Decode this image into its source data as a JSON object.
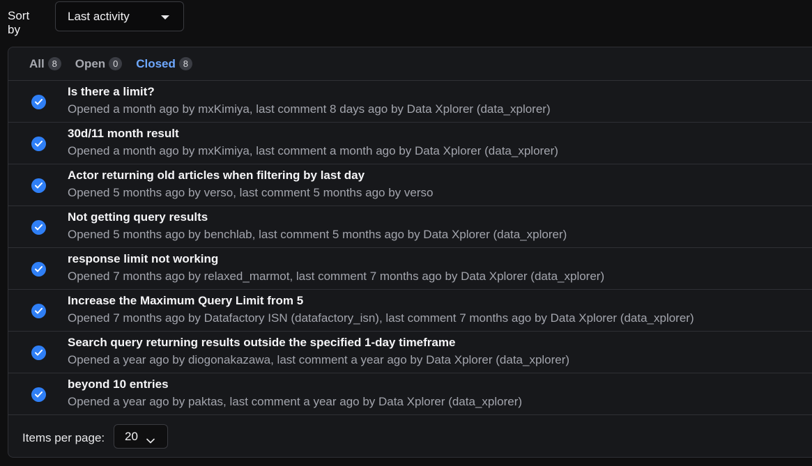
{
  "sort": {
    "label": "Sort by",
    "value": "Last activity"
  },
  "tabs": [
    {
      "label": "All",
      "count": "8"
    },
    {
      "label": "Open",
      "count": "0"
    },
    {
      "label": "Closed",
      "count": "8"
    }
  ],
  "issues": [
    {
      "title": "Is there a limit?",
      "meta": "Opened a month ago by mxKimiya, last comment 8 days ago by Data Xplorer (data_xplorer)"
    },
    {
      "title": "30d/11 month result",
      "meta": "Opened a month ago by mxKimiya, last comment a month ago by Data Xplorer (data_xplorer)"
    },
    {
      "title": "Actor returning old articles when filtering by last day",
      "meta": "Opened 5 months ago by verso, last comment 5 months ago by verso"
    },
    {
      "title": "Not getting query results",
      "meta": "Opened 5 months ago by benchlab, last comment 5 months ago by Data Xplorer (data_xplorer)"
    },
    {
      "title": "response limit not working",
      "meta": "Opened 7 months ago by relaxed_marmot, last comment 7 months ago by Data Xplorer (data_xplorer)"
    },
    {
      "title": "Increase the Maximum Query Limit from 5",
      "meta": "Opened 7 months ago by Datafactory ISN (datafactory_isn), last comment 7 months ago by Data Xplorer (data_xplorer)"
    },
    {
      "title": "Search query returning results outside the specified 1-day timeframe",
      "meta": "Opened a year ago by diogonakazawa, last comment a year ago by Data Xplorer (data_xplorer)"
    },
    {
      "title": "beyond 10 entries",
      "meta": "Opened a year ago by paktas, last comment a year ago by Data Xplorer (data_xplorer)"
    }
  ],
  "pagination": {
    "items_per_page_label": "Items per page:",
    "items_per_page_value": "20"
  },
  "colors": {
    "accent": "#6ea8ff",
    "check": "#2f7ff6",
    "background": "#0f0f10",
    "panel": "#17181b"
  },
  "icons": {
    "sort_caret": "caret-down-icon",
    "issue_status": "check-circle-icon",
    "ipp_chevron": "chevron-down-icon"
  }
}
